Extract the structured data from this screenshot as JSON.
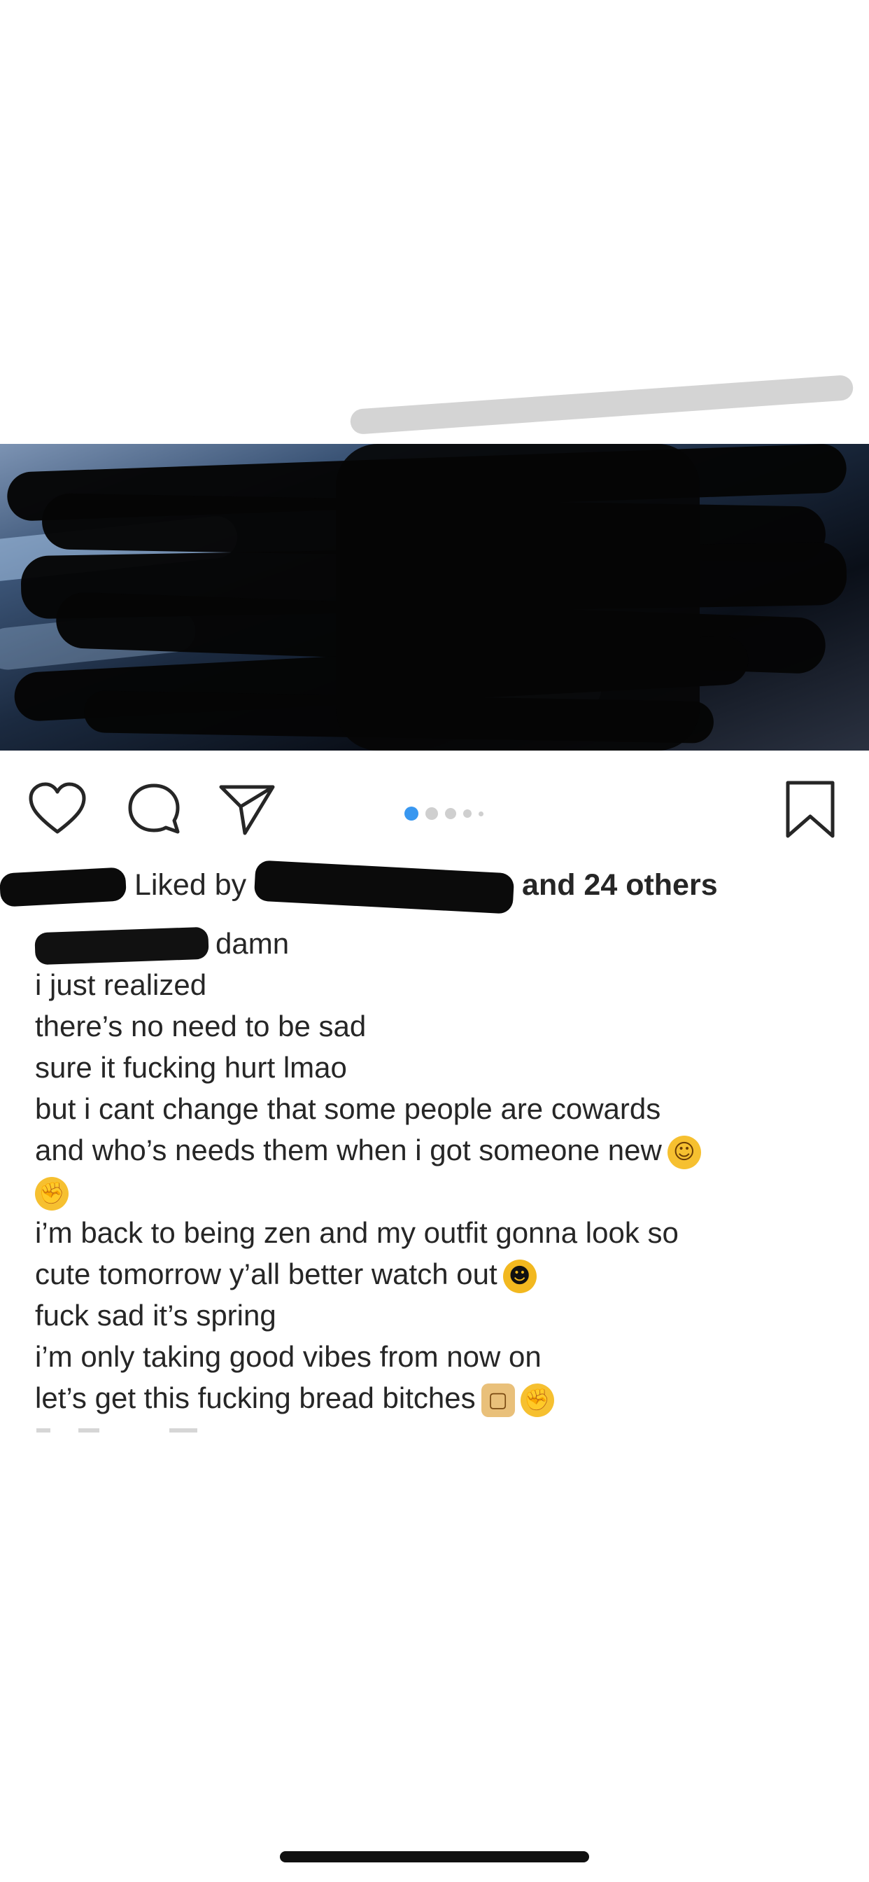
{
  "post": {
    "likes": {
      "prefix": "Liked by",
      "suffix": "and 24 others"
    },
    "caption": {
      "first_line_text": "damn",
      "lines": [
        "i just realized",
        "there’s no need to be sad",
        "sure it fucking hurt lmao",
        "but i cant change that some people are cowards",
        "and who’s needs them when i got someone new",
        "",
        "i’m back to being zen and my outfit gonna look so",
        "cute tomorrow y’all better watch out",
        "fuck sad it’s spring",
        "i’m only taking good vibes from now on",
        "let’s get this fucking bread bitches"
      ]
    },
    "carousel": {
      "current_index": 1,
      "total": 5
    }
  },
  "icons": {
    "like": "heart-icon",
    "comment": "comment-icon",
    "share": "send-icon",
    "save": "bookmark-icon",
    "emoji_relieved": "relieved-face-emoji",
    "emoji_fist": "raised-fist-emoji",
    "emoji_sunglasses": "sunglasses-face-emoji",
    "emoji_bread": "bread-emoji",
    "emoji_punch": "fist-bump-emoji"
  },
  "colors": {
    "text": "#262626",
    "carousel_active": "#3897f0",
    "carousel_inactive": "#cfcfcf",
    "redaction": "#0b0b0b"
  }
}
